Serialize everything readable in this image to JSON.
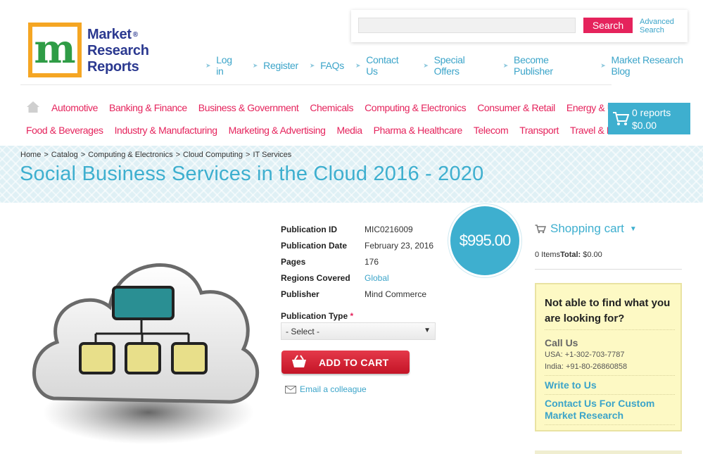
{
  "logo": {
    "mark": "m",
    "line1": "Market",
    "line2": "Research",
    "line3": "Reports",
    "registered": "®"
  },
  "search": {
    "placeholder": "",
    "button": "Search",
    "advanced": "Advanced Search"
  },
  "top_links": [
    "Log in",
    "Register",
    "FAQs",
    "Contact Us",
    "Special Offers",
    "Become Publisher",
    "Market Research Blog"
  ],
  "categories_row1": [
    "Automotive",
    "Banking & Finance",
    "Business & Government",
    "Chemicals",
    "Computing & Electronics",
    "Consumer & Retail",
    "Energy & Utilities"
  ],
  "categories_row2": [
    "Food & Beverages",
    "Industry & Manufacturing",
    "Marketing & Advertising",
    "Media",
    "Pharma & Healthcare",
    "Telecom",
    "Transport",
    "Travel & Leisure"
  ],
  "cart": {
    "reports": "0 reports",
    "amount": "$0.00"
  },
  "breadcrumb": [
    "Home",
    "Catalog",
    "Computing & Electronics",
    "Cloud Computing",
    "IT Services"
  ],
  "breadcrumb_sep": ">",
  "title": "Social Business Services in the Cloud 2016 - 2020",
  "details": [
    {
      "label": "Publication ID",
      "value": "MIC0216009"
    },
    {
      "label": "Publication Date",
      "value": "February 23, 2016"
    },
    {
      "label": "Pages",
      "value": "176"
    },
    {
      "label": "Regions Covered",
      "value": "Global"
    },
    {
      "label": "Publisher",
      "value": "Mind Commerce"
    }
  ],
  "pubtype": {
    "label": "Publication Type",
    "required": "*",
    "selected": "- Select -"
  },
  "add_to_cart": "ADD TO CART",
  "email_colleague": "Email a colleague",
  "price": "$995.00",
  "sidebar": {
    "cart_title": "Shopping cart",
    "items_label": "0 Items",
    "total_label": "Total:",
    "total_value": "$0.00",
    "help_question": "Not able to find what you are looking for?",
    "call_us": "Call Us",
    "usa": "USA: +1-302-703-7787",
    "india": "India: +91-80-26860858",
    "write_to_us": "Write to Us",
    "contact_custom": "Contact Us For Custom Market Research"
  },
  "colors": {
    "accent_pink": "#e5235c",
    "accent_blue": "#3eafcf",
    "link_blue": "#3ba4c9",
    "logo_orange": "#f5a623",
    "logo_green": "#2f9c46",
    "logo_navy": "#2b3990",
    "cart_red": "#c41426"
  },
  "icons": [
    "home-icon",
    "cart-icon",
    "basket-icon",
    "envelope-icon",
    "chevron-down-icon",
    "arrow-right-icon",
    "cloud-network-image"
  ]
}
